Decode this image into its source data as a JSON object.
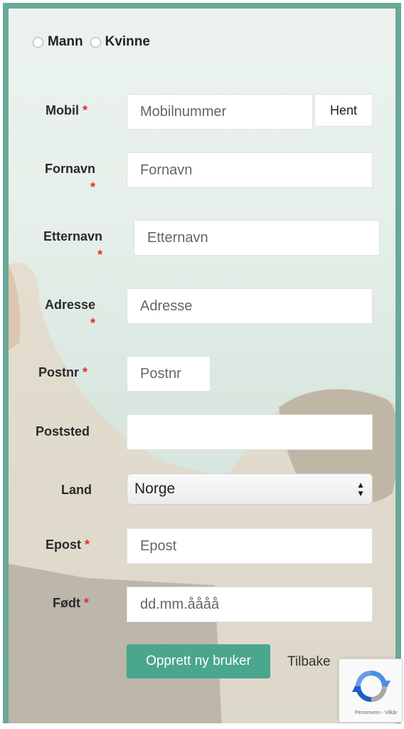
{
  "gender": {
    "options": [
      {
        "label": "Mann"
      },
      {
        "label": "Kvinne"
      }
    ]
  },
  "fields": {
    "mobil": {
      "label": "Mobil",
      "placeholder": "Mobilnummer",
      "button": "Hent"
    },
    "fornavn": {
      "label": "Fornavn",
      "placeholder": "Fornavn"
    },
    "etternavn": {
      "label": "Etternavn",
      "placeholder": "Etternavn"
    },
    "adresse": {
      "label": "Adresse",
      "placeholder": "Adresse"
    },
    "postnr": {
      "label": "Postnr",
      "placeholder": "Postnr"
    },
    "poststed": {
      "label": "Poststed",
      "placeholder": ""
    },
    "land": {
      "label": "Land",
      "value": "Norge"
    },
    "epost": {
      "label": "Epost",
      "placeholder": "Epost"
    },
    "fodt": {
      "label": "Født",
      "placeholder": "dd.mm.åååå"
    }
  },
  "required_mark": "*",
  "actions": {
    "submit": "Opprett ny bruker",
    "back": "Tilbake"
  },
  "recaptcha": {
    "text": "Personvern - Vilkår"
  },
  "colors": {
    "frame": "#6aa89a",
    "primary": "#4aa68c",
    "required": "#e32b2b"
  }
}
